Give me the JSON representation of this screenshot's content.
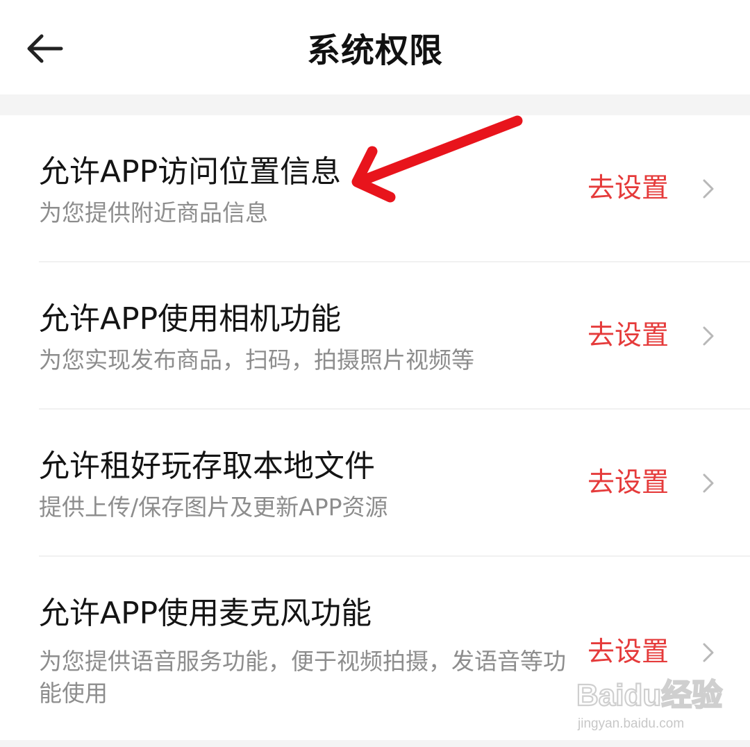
{
  "header": {
    "title": "系统权限",
    "back_icon": "arrow-left-icon"
  },
  "permissions": [
    {
      "title": "允许APP访问位置信息",
      "description": "为您提供附近商品信息",
      "action_label": "去设置"
    },
    {
      "title": "允许APP使用相机功能",
      "description": "为您实现发布商品，扫码，拍摄照片视频等",
      "action_label": "去设置"
    },
    {
      "title": "允许租好玩存取本地文件",
      "description": "提供上传/保存图片及更新APP资源",
      "action_label": "去设置"
    },
    {
      "title": "允许APP使用麦克风功能",
      "description": "为您提供语音服务功能，便于视频拍摄，发语音等功能使用",
      "action_label": "去设置"
    }
  ],
  "watermark": {
    "brand": "Baidu经验",
    "url": "jingyan.baidu.com"
  },
  "colors": {
    "action": "#e53b3b",
    "annotation_arrow": "#e8141c",
    "title_text": "#141414",
    "description_text": "#8d8d8d"
  }
}
